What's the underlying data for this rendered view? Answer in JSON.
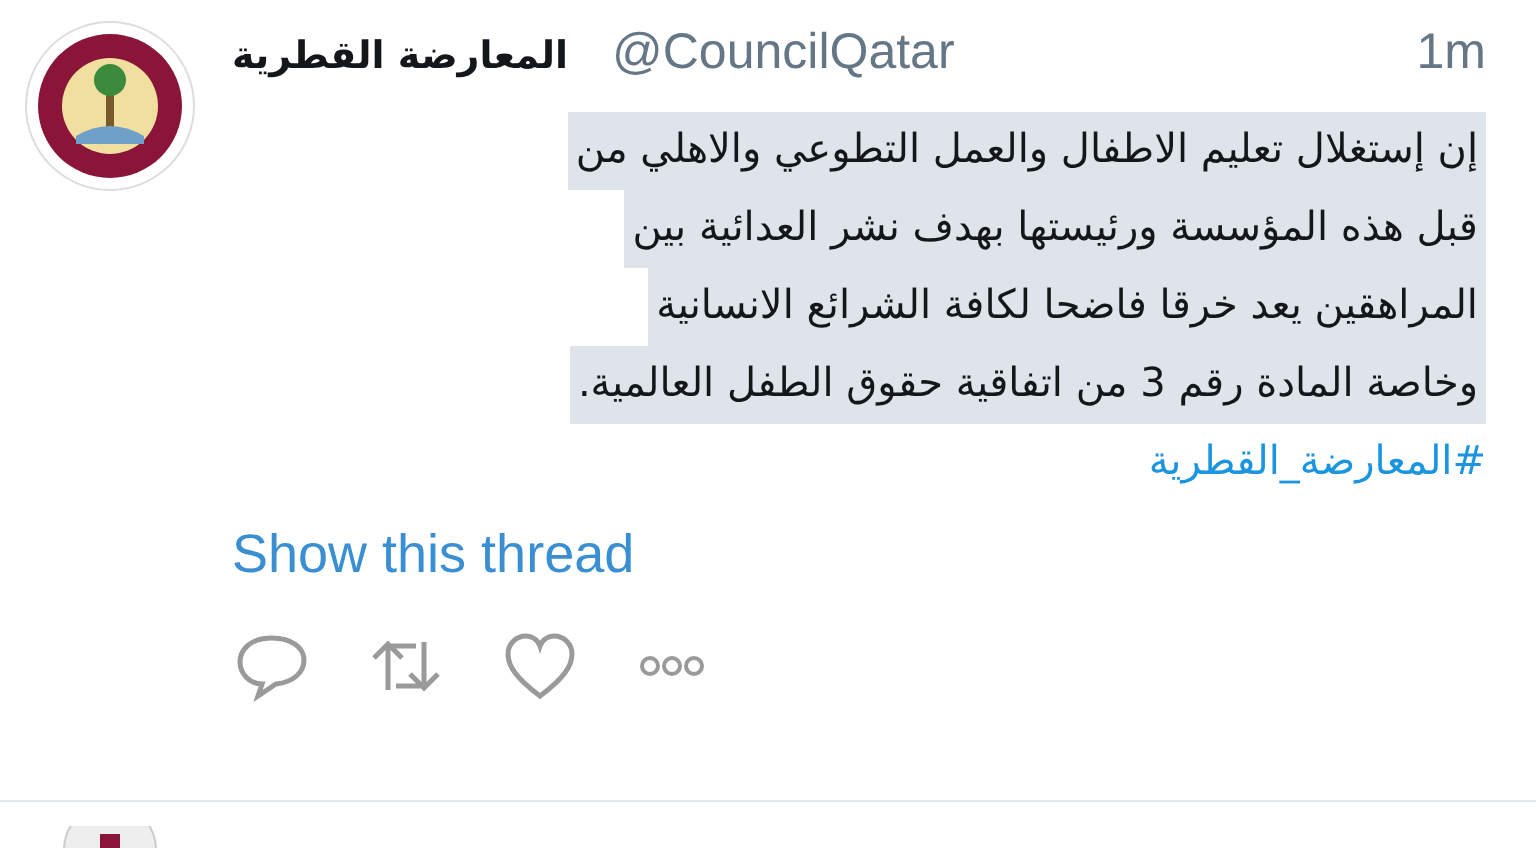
{
  "tweet": {
    "author_name": "المعارضة القطرية",
    "handle": "@CouncilQatar",
    "time": "1m",
    "text_lines": [
      "إن إستغلال تعليم الاطفال والعمل التطوعي والاهلي من",
      "قبل هذه المؤسسة ورئيستها  بهدف نشر العدائية بين",
      "المراهقين يعد  خرقا فاضحا لكافة الشرائع الانسانية",
      "وخاصة المادة رقم 3 من اتفاقية حقوق الطفل العالمية."
    ],
    "hashtag": "#المعارضة_القطرية",
    "thread_link": "Show this thread",
    "selected": true
  }
}
